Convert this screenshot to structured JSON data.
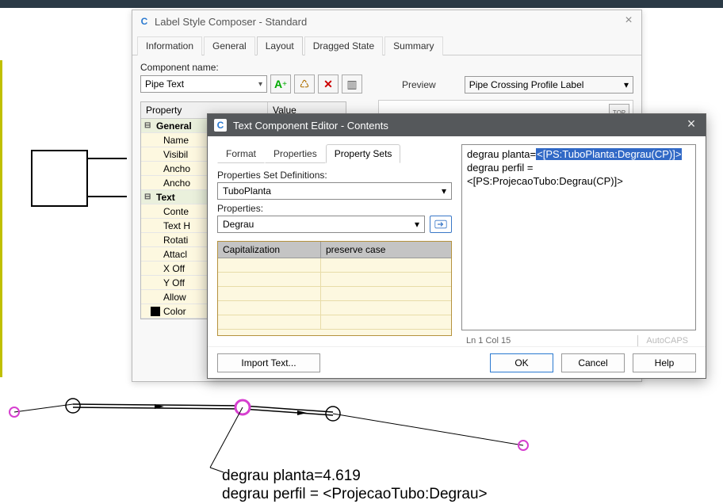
{
  "label_composer": {
    "title": "Label Style Composer - Standard",
    "tabs": [
      "Information",
      "General",
      "Layout",
      "Dragged State",
      "Summary"
    ],
    "active_tab": "Layout",
    "component_label": "Component name:",
    "component_value": "Pipe Text",
    "preview_label": "Preview",
    "preview_value": "Pipe Crossing Profile Label",
    "top_button": "TOP",
    "prop_header_name": "Property",
    "prop_header_value": "Value",
    "groups": [
      {
        "name": "General",
        "rows": [
          "Name",
          "Visibil",
          "Ancho",
          "Ancho"
        ]
      },
      {
        "name": "Text",
        "rows": [
          "Conte",
          "Text H",
          "Rotati",
          "Attacl",
          "X Off",
          "Y Off",
          "Allow"
        ]
      }
    ],
    "color_row": "Color"
  },
  "text_editor": {
    "title": "Text Component Editor - Contents",
    "tabs": [
      "Format",
      "Properties",
      "Property Sets"
    ],
    "active_tab": "Property Sets",
    "defs_label": "Properties Set Definitions:",
    "defs_value": "TuboPlanta",
    "props_label": "Properties:",
    "props_value": "Degrau",
    "cap_header_name": "Capitalization",
    "cap_header_value": "preserve case",
    "content_line1_pre": "degrau planta=",
    "content_line1_hl": "<[PS:TuboPlanta:Degrau(CP)]>",
    "content_line2": "degrau perfil = <[PS:ProjecaoTubo:Degrau(CP)]>",
    "status_pos": "Ln 1 Col 15",
    "status_caps": "AutoCAPS",
    "buttons": {
      "import": "Import Text...",
      "ok": "OK",
      "cancel": "Cancel",
      "help": "Help"
    }
  },
  "canvas_note": {
    "line1": "degrau planta=4.619",
    "line2": "degrau perfil = <ProjecaoTubo:Degrau>"
  }
}
